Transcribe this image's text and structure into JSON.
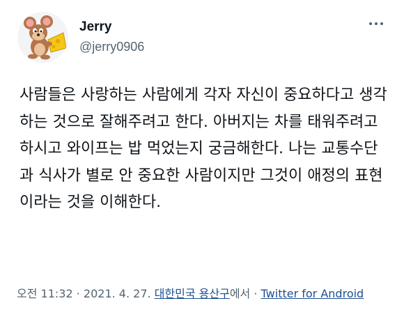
{
  "user": {
    "display_name": "Jerry",
    "handle": "@jerry0906",
    "avatar_icon": "jerry-mouse-avatar"
  },
  "menu": {
    "more_icon": "more-horizontal-icon"
  },
  "tweet": {
    "text": "사람들은 사랑하는 사람에게 각자 자신이 중요하다고 생각하는 것으로 잘해주려고 한다. 아버지는 차를 태워주려고 하시고 와이프는 밥 먹었는지 궁금해한다. 나는 교통수단과 식사가 별로 안 중요한 사람이지만 그것이 애정의 표현이라는 것을 이해한다."
  },
  "meta": {
    "time": "오전 11:32",
    "separator": " · ",
    "date": "2021. 4. 27.",
    "location": "대한민국 용산구",
    "location_suffix": "에서",
    "source": "Twitter for Android"
  },
  "colors": {
    "text": "#0f1419",
    "secondary": "#536471",
    "link": "#1d4f91"
  }
}
